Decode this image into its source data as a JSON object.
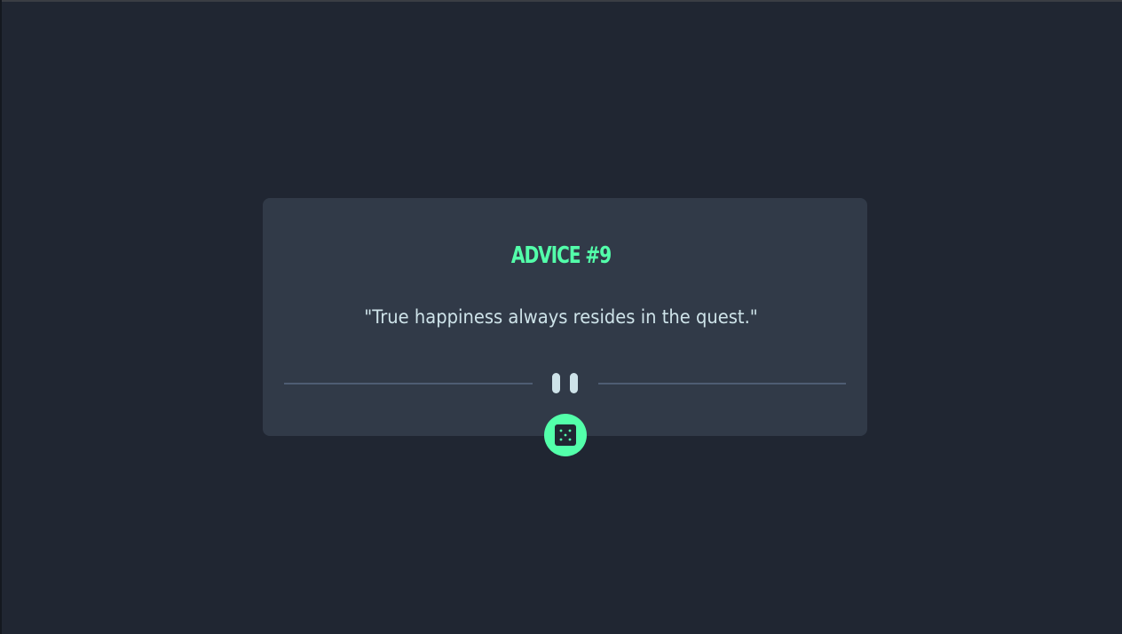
{
  "advice": {
    "title": "ADVICE #9",
    "quote": "\"True happiness always resides in the quest.\""
  },
  "divider": {
    "icon": "pause-icon"
  },
  "generate_button": {
    "icon": "dice-icon"
  },
  "colors": {
    "background": "#202632",
    "card": "#313a48",
    "accent": "#53ffaa",
    "text": "#cee3e9",
    "divider": "#4e5d73"
  }
}
